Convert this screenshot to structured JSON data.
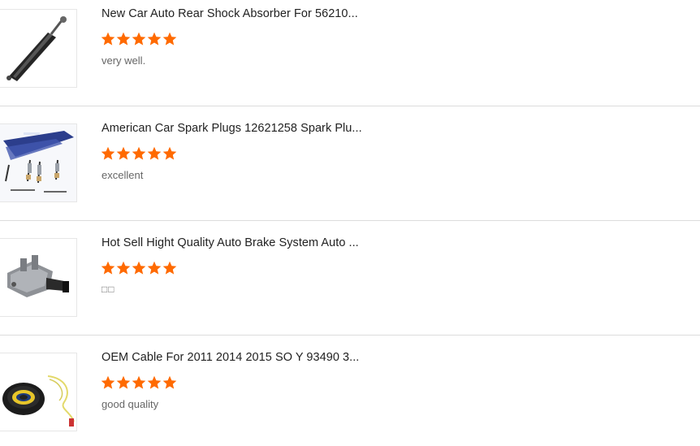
{
  "rating_color": "#ff6a00",
  "reviews": [
    {
      "title": "New Car Auto Rear Shock Absorber For 56210...",
      "rating": 5,
      "comment": "very well.",
      "image_icon": "shock-absorber-icon"
    },
    {
      "title": "American Car Spark Plugs 12621258 Spark Plu...",
      "rating": 5,
      "comment": "excellent",
      "image_icon": "spark-plugs-icon"
    },
    {
      "title": "Hot Sell Hight Quality Auto Brake System Auto ...",
      "rating": 5,
      "comment": "□□",
      "image_icon": "brake-master-cylinder-icon"
    },
    {
      "title": "OEM Cable For 2011 2014 2015 SO Y 93490 3...",
      "rating": 5,
      "comment": "good quality",
      "image_icon": "clock-spring-cable-icon"
    }
  ]
}
